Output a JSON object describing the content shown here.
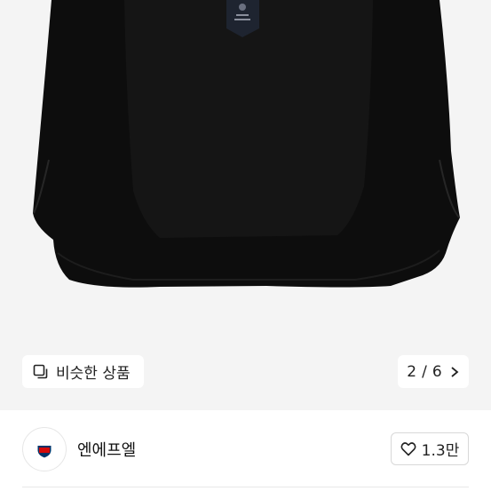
{
  "product_image": {
    "alt": "black jacket lining view",
    "background": "#f4f4f4",
    "garment_color": "#0b0b0b"
  },
  "similar_button": {
    "label": "비슷한 상품",
    "icon": "similar-items-icon"
  },
  "pager": {
    "current": "2",
    "separator": "/",
    "total": "6",
    "text": "2 / 6",
    "icon": "chevron-right-icon"
  },
  "store": {
    "name": "엔에프엘",
    "logo": "nfl-shield-logo"
  },
  "like_button": {
    "count": "1.3만",
    "icon": "heart-outline-icon"
  },
  "colors": {
    "chip_bg": "#ffffff",
    "text": "#222222",
    "border": "#d8d8d8"
  }
}
